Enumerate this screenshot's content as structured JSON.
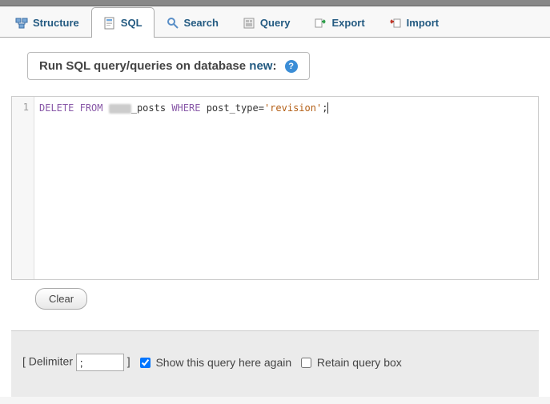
{
  "tabs": {
    "structure": "Structure",
    "sql": "SQL",
    "search": "Search",
    "query": "Query",
    "export": "Export",
    "import": "Import"
  },
  "header": {
    "prefix": "Run SQL query/queries on database ",
    "dbname": "new",
    "suffix": ":",
    "help": "?"
  },
  "editor": {
    "line_no": "1",
    "kw_delete": "DELETE",
    "kw_from": "FROM",
    "table_suffix": "_posts",
    "kw_where": "WHERE",
    "column": "post_type",
    "eq": "=",
    "value": "'revision'",
    "terminator": ";"
  },
  "buttons": {
    "clear": "Clear"
  },
  "bottom": {
    "delim_open": "[ Delimiter",
    "delim_value": ";",
    "delim_close": "]",
    "show_again": "Show this query here again",
    "retain": "Retain query box"
  }
}
